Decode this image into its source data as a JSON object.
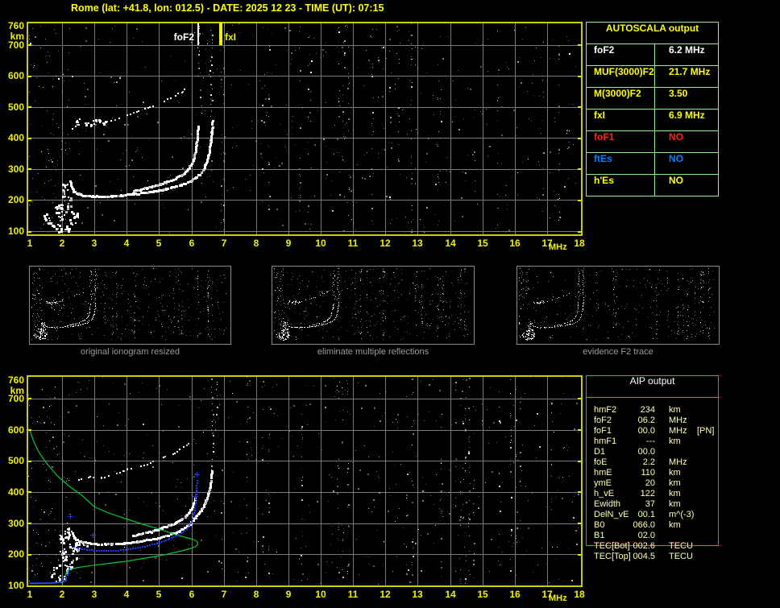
{
  "title": "Rome (lat: +41.8, lon: 012.5) - DATE: 2025 12 23 - TIME (UT): 07:15",
  "colors": {
    "axis": "#f2f200",
    "border": "#cccc00",
    "grid": "#787878",
    "autoscala_border": "#90ee90",
    "aip_border": "#00c832",
    "aip_text": "#ffffb4",
    "caption": "#9a9a9a",
    "green_trace": "#00c832",
    "blue_trace": "#2336ee"
  },
  "autoscala": {
    "header": "AUTOSCALA output",
    "rows": [
      {
        "label": "foF2",
        "value": "6.2 MHz",
        "color": "#ffffff"
      },
      {
        "label": "MUF(3000)F2",
        "value": "21.7 MHz",
        "color": "#ffff00"
      },
      {
        "label": "M(3000)F2",
        "value": "3.50",
        "color": "#ffff00"
      },
      {
        "label": "fxI",
        "value": "6.9 MHz",
        "color": "#ffff00"
      },
      {
        "label": "foF1",
        "value": "NO",
        "color": "#ff2020"
      },
      {
        "label": "ftEs",
        "value": "NO",
        "color": "#0080ff"
      },
      {
        "label": "h'Es",
        "value": "NO",
        "color": "#ffff00"
      }
    ]
  },
  "aip": {
    "header": "AIP output",
    "rows": [
      {
        "label": "hmF2",
        "value": "234",
        "unit": "km",
        "note": ""
      },
      {
        "label": "foF2",
        "value": "06.2",
        "unit": "MHz",
        "note": ""
      },
      {
        "label": "foF1",
        "value": "00.0",
        "unit": "MHz",
        "note": "[PN]"
      },
      {
        "label": "hmF1",
        "value": "---",
        "unit": "km",
        "note": ""
      },
      {
        "label": "D1",
        "value": "00.0",
        "unit": "",
        "note": ""
      },
      {
        "label": "foE",
        "value": "2.2",
        "unit": "MHz",
        "note": ""
      },
      {
        "label": "hmE",
        "value": "110",
        "unit": "km",
        "note": ""
      },
      {
        "label": "ymE",
        "value": "20",
        "unit": "km",
        "note": ""
      },
      {
        "label": "h_vE",
        "value": "122",
        "unit": "km",
        "note": ""
      },
      {
        "label": "Ewidth",
        "value": "37",
        "unit": "km",
        "note": ""
      },
      {
        "label": "DelN_vE",
        "value": "00.1",
        "unit": "m^(-3)",
        "note": ""
      },
      {
        "label": "B0",
        "value": "066.0",
        "unit": "km",
        "note": ""
      },
      {
        "label": "B1",
        "value": "02.0",
        "unit": "",
        "note": ""
      },
      {
        "label": "TEC[Bot]",
        "value": "002.6",
        "unit": "TECU",
        "note": ""
      },
      {
        "label": "TEC[Top]",
        "value": "004.5",
        "unit": "TECU",
        "note": ""
      }
    ]
  },
  "thumbnails": [
    {
      "caption": "original ionogram resized"
    },
    {
      "caption": "eliminate multiple reflections"
    },
    {
      "caption": "evidence F2 trace"
    }
  ],
  "ionogram": {
    "x_ticks": [
      "1",
      "2",
      "3",
      "4",
      "5",
      "6",
      "7",
      "8",
      "9",
      "10",
      "11",
      "12",
      "13",
      "14",
      "15",
      "16",
      "17",
      "18"
    ],
    "x_unit": "MHz",
    "y_top": "760",
    "y_unit": "km",
    "y_ticks": [
      "700",
      "600",
      "500",
      "400",
      "300",
      "200",
      "100"
    ],
    "x_range": [
      1,
      18
    ],
    "y_range": [
      100,
      760
    ],
    "markers": [
      {
        "label": "foF2",
        "freq": 6.2,
        "color": "#ffffff",
        "width": 2,
        "label_side": "left"
      },
      {
        "label": "fxI",
        "freq": 6.9,
        "color": "#f2f200",
        "width": 4,
        "label_side": "right"
      }
    ]
  },
  "traces": {
    "f_flat": [
      [
        2.25,
        262
      ],
      [
        2.28,
        244
      ],
      [
        2.35,
        230
      ],
      [
        2.5,
        221
      ],
      [
        2.7,
        216
      ],
      [
        3.0,
        213
      ],
      [
        3.4,
        213
      ],
      [
        3.8,
        216
      ],
      [
        4.2,
        221
      ]
    ],
    "o_branch": [
      [
        4.2,
        230
      ],
      [
        4.6,
        240
      ],
      [
        5.0,
        252
      ],
      [
        5.4,
        266
      ],
      [
        5.7,
        282
      ],
      [
        5.9,
        302
      ],
      [
        6.05,
        332
      ],
      [
        6.12,
        368
      ],
      [
        6.18,
        406
      ],
      [
        6.2,
        440
      ]
    ],
    "x_branch": [
      [
        4.2,
        221
      ],
      [
        4.7,
        227
      ],
      [
        5.2,
        237
      ],
      [
        5.7,
        251
      ],
      [
        6.0,
        265
      ],
      [
        6.25,
        284
      ],
      [
        6.4,
        308
      ],
      [
        6.5,
        338
      ],
      [
        6.57,
        378
      ],
      [
        6.62,
        420
      ],
      [
        6.64,
        458
      ]
    ],
    "second_hop": [
      [
        2.3,
        432
      ],
      [
        2.6,
        446
      ],
      [
        2.95,
        455
      ],
      [
        3.3,
        450
      ],
      [
        3.65,
        460
      ],
      [
        4.0,
        472
      ],
      [
        4.35,
        486
      ],
      [
        4.7,
        500
      ],
      [
        5.05,
        515
      ],
      [
        5.4,
        532
      ],
      [
        5.7,
        550
      ],
      [
        5.95,
        566
      ]
    ],
    "e_blobs": [
      [
        1.5,
        150
      ],
      [
        1.55,
        135
      ],
      [
        1.65,
        122
      ],
      [
        1.78,
        112
      ],
      [
        1.9,
        107
      ],
      [
        2.05,
        105
      ],
      [
        2.2,
        111
      ],
      [
        2.32,
        124
      ],
      [
        1.93,
        128
      ],
      [
        1.97,
        148
      ],
      [
        2.03,
        168
      ],
      [
        1.98,
        188
      ],
      [
        2.08,
        205
      ],
      [
        2.04,
        226
      ],
      [
        2.12,
        243
      ],
      [
        2.07,
        258
      ],
      [
        2.3,
        140
      ],
      [
        2.38,
        158
      ],
      [
        2.42,
        148
      ],
      [
        2.22,
        182
      ],
      [
        2.27,
        203
      ],
      [
        1.87,
        163
      ],
      [
        1.84,
        178
      ],
      [
        2.5,
        452
      ],
      [
        2.75,
        444
      ],
      [
        3.1,
        455
      ],
      [
        2.9,
        440
      ],
      [
        3.3,
        450
      ]
    ],
    "streaks_top": [
      [
        6.62,
        470,
        770
      ],
      [
        6.22,
        600,
        760
      ],
      [
        6.3,
        480,
        560
      ]
    ],
    "f_flat2": [
      [
        2.32,
        268
      ],
      [
        2.38,
        252
      ],
      [
        2.55,
        243
      ],
      [
        2.8,
        238
      ],
      [
        3.1,
        235
      ],
      [
        3.5,
        234
      ],
      [
        3.9,
        237
      ],
      [
        4.3,
        242
      ]
    ],
    "x_branch2": [
      [
        4.3,
        242
      ],
      [
        4.8,
        250
      ],
      [
        5.2,
        260
      ],
      [
        5.6,
        275
      ],
      [
        5.9,
        294
      ],
      [
        6.1,
        318
      ],
      [
        6.3,
        346
      ],
      [
        6.45,
        375
      ],
      [
        6.55,
        408
      ],
      [
        6.6,
        442
      ],
      [
        6.62,
        470
      ]
    ],
    "o_branch2": [
      [
        4.2,
        262
      ],
      [
        4.7,
        273
      ],
      [
        5.1,
        286
      ],
      [
        5.5,
        302
      ],
      [
        5.8,
        322
      ],
      [
        6.0,
        350
      ],
      [
        6.1,
        382
      ]
    ],
    "second_hop2": [
      [
        2.5,
        438
      ],
      [
        2.85,
        450
      ],
      [
        3.2,
        446
      ],
      [
        3.55,
        458
      ],
      [
        3.9,
        468
      ],
      [
        4.3,
        480
      ],
      [
        4.7,
        494
      ],
      [
        5.1,
        510
      ],
      [
        5.45,
        526
      ],
      [
        5.75,
        544
      ],
      [
        5.95,
        560
      ]
    ],
    "e_blobs2": [
      [
        1.78,
        150
      ],
      [
        1.74,
        136
      ],
      [
        1.84,
        121
      ],
      [
        1.98,
        126
      ],
      [
        2.0,
        255
      ],
      [
        1.95,
        236
      ],
      [
        2.0,
        214
      ],
      [
        2.06,
        199
      ],
      [
        2.1,
        184
      ],
      [
        1.99,
        174
      ],
      [
        2.1,
        158
      ],
      [
        2.2,
        149
      ],
      [
        2.3,
        164
      ],
      [
        2.36,
        186
      ],
      [
        2.26,
        209
      ],
      [
        2.3,
        229
      ],
      [
        2.4,
        224
      ],
      [
        2.5,
        217
      ],
      [
        2.18,
        256
      ],
      [
        2.14,
        270
      ],
      [
        2.24,
        284
      ],
      [
        2.45,
        242
      ],
      [
        2.6,
        236
      ],
      [
        2.75,
        232
      ]
    ],
    "streaks_bottom": [
      [
        6.65,
        470,
        780
      ],
      [
        6.78,
        600,
        770
      ]
    ],
    "green_profile": [
      [
        1.0,
        598
      ],
      [
        1.12,
        562
      ],
      [
        1.3,
        524
      ],
      [
        1.55,
        488
      ],
      [
        1.85,
        452
      ],
      [
        2.2,
        420
      ],
      [
        2.6,
        390
      ],
      [
        3.0,
        352
      ],
      [
        3.5,
        330
      ],
      [
        4.0,
        313
      ],
      [
        4.5,
        296
      ],
      [
        5.0,
        281
      ],
      [
        5.5,
        263
      ],
      [
        5.9,
        252
      ],
      [
        6.1,
        246
      ],
      [
        6.18,
        240
      ],
      [
        6.2,
        232
      ],
      [
        6.12,
        224
      ],
      [
        5.9,
        216
      ],
      [
        5.6,
        209
      ],
      [
        5.2,
        199
      ],
      [
        4.6,
        188
      ],
      [
        4.0,
        178
      ],
      [
        3.4,
        170
      ],
      [
        2.9,
        164
      ],
      [
        2.5,
        158
      ],
      [
        2.25,
        152
      ],
      [
        2.15,
        146
      ],
      [
        2.1,
        131
      ],
      [
        2.12,
        116
      ],
      [
        2.0,
        110
      ],
      [
        1.7,
        108
      ],
      [
        1.4,
        107
      ],
      [
        1.0,
        106
      ]
    ],
    "blue_base": [
      [
        1.0,
        108
      ],
      [
        1.25,
        108
      ],
      [
        1.5,
        109
      ],
      [
        1.75,
        110
      ],
      [
        1.95,
        113
      ],
      [
        2.05,
        118
      ],
      [
        2.12,
        127
      ],
      [
        2.18,
        142
      ],
      [
        2.22,
        158
      ],
      [
        2.24,
        168
      ]
    ],
    "blue_f": [
      [
        2.35,
        225
      ],
      [
        2.6,
        218
      ],
      [
        2.9,
        214
      ],
      [
        3.2,
        212
      ],
      [
        3.5,
        212
      ],
      [
        3.8,
        214
      ],
      [
        4.1,
        218
      ],
      [
        4.4,
        223
      ],
      [
        4.7,
        230
      ],
      [
        5.0,
        239
      ],
      [
        5.3,
        250
      ],
      [
        5.6,
        264
      ],
      [
        5.85,
        282
      ],
      [
        6.0,
        305
      ],
      [
        6.08,
        335
      ],
      [
        6.12,
        370
      ],
      [
        6.15,
        405
      ],
      [
        6.17,
        438
      ]
    ],
    "blue_marks": [
      [
        2.25,
        322
      ],
      [
        2.95,
        262
      ],
      [
        6.17,
        455
      ],
      [
        6.12,
        385
      ]
    ]
  }
}
